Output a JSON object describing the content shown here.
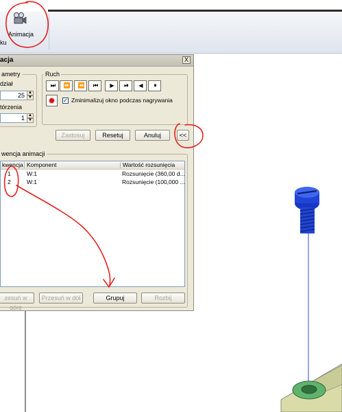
{
  "ribbon": {
    "animation_label": "Animacja",
    "partial_label": "ku"
  },
  "dialog": {
    "title": "acja",
    "close_label": "X",
    "params_group": {
      "label": "ametry",
      "division_label": "dział",
      "division_value": "25",
      "repeat_label": "tórzenia",
      "repeat_value": "1"
    },
    "motion_group": {
      "label": "Ruch",
      "buttons": [
        "⏭",
        "⏩",
        "⏪",
        "⏮",
        "▶",
        "⏯",
        "◀",
        "⏸"
      ],
      "minimize_checked": true,
      "minimize_label": "Zminimalizuj okno podczas nagrywania"
    },
    "actions": {
      "apply": "Zastosuj",
      "reset": "Resetuj",
      "cancel": "Anuluj",
      "collapse": "<<"
    },
    "sequence_group": {
      "label": "wencja animacji",
      "columns": [
        "kwencja",
        "Komponent",
        "Wartość rozsunięcia"
      ],
      "rows": [
        {
          "seq": "1",
          "component": "W:1",
          "value": "Rozsunięcie (360,00 d..."
        },
        {
          "seq": "2",
          "component": "W:1",
          "value": "Rozsunięcie (100,000 ..."
        }
      ]
    },
    "bottom_buttons": {
      "move_up": "zesuń w górę",
      "move_down": "Przesuń w dół",
      "group": "Grupuj",
      "ungroup": "Rozbij"
    }
  },
  "colors": {
    "annotation": "#e5211d",
    "screw_blue": "#1637c6",
    "washer_green": "#5fb36d",
    "dialog_bg": "#ece9d8"
  }
}
